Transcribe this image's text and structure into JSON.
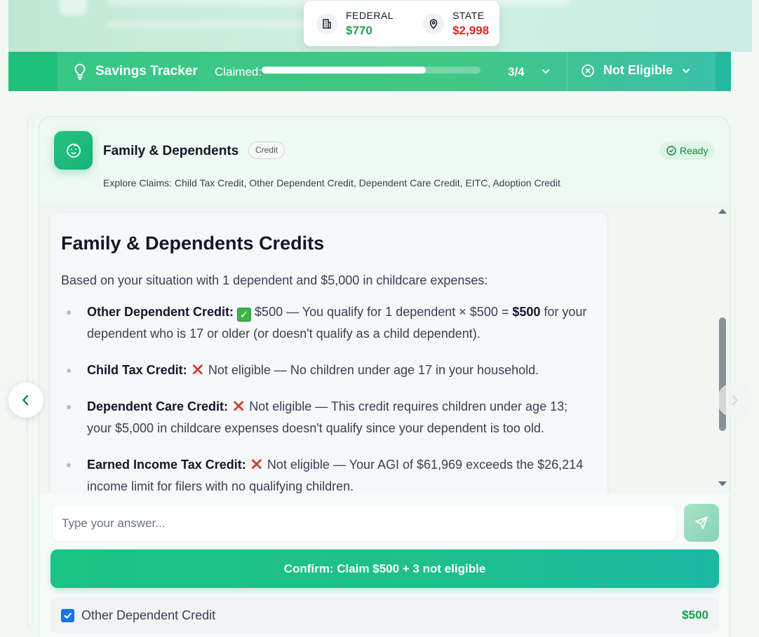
{
  "header": {
    "federal": {
      "label": "FEDERAL",
      "value": "$770",
      "color": "#22a052"
    },
    "state": {
      "label": "STATE",
      "value": "$2,998",
      "color": "#dc2626"
    }
  },
  "tracker": {
    "title": "Savings Tracker",
    "claimed_label": "Claimed:",
    "progress_fraction": 0.75,
    "progress_text": "3/4",
    "not_eligible_label": "Not Eligible"
  },
  "card": {
    "title": "Family & Dependents",
    "badge": "Credit",
    "status": "Ready",
    "explore_text": "Explore Claims: Child Tax Credit, Other Dependent Credit, Dependent Care Credit, EITC, Adoption Credit"
  },
  "message": {
    "title": "Family & Dependents Credits",
    "intro": "Based on your situation with 1 dependent and $5,000 in childcare expenses:",
    "items": [
      {
        "label": "Other Dependent Credit:",
        "status": "eligible",
        "text_before_bold": "$500 — You qualify for 1 dependent × $500 = ",
        "bold": "$500",
        "text_after_bold": " for your dependent who is 17 or older (or doesn't qualify as a child dependent)."
      },
      {
        "label": "Child Tax Credit:",
        "status": "not-eligible",
        "text": "Not eligible — No children under age 17 in your household."
      },
      {
        "label": "Dependent Care Credit:",
        "status": "not-eligible",
        "text": "Not eligible — This credit requires children under age 13; your $5,000 in childcare expenses doesn't qualify since your dependent is too old."
      },
      {
        "label": "Earned Income Tax Credit:",
        "status": "not-eligible",
        "text": "Not eligible — Your AGI of $61,969 exceeds the $26,214 income limit for filers with no qualifying children."
      }
    ]
  },
  "input": {
    "placeholder": "Type your answer...",
    "value": ""
  },
  "confirm_label": "Confirm: Claim $500 + 3 not eligible",
  "claims": [
    {
      "label": "Other Dependent Credit",
      "amount": "$500",
      "checked": true
    }
  ],
  "icons": {
    "federal": "building-icon",
    "state": "map-pin-icon",
    "tracker": "lightbulb-icon",
    "not_eligible": "x-circle-icon",
    "card": "baby-face-icon",
    "ready": "check-circle-icon",
    "send": "send-icon",
    "prev": "chevron-left-icon",
    "next": "chevron-right-icon"
  },
  "colors": {
    "accent": "#1fc07a",
    "positive": "#16a34a",
    "negative": "#dc2626"
  }
}
